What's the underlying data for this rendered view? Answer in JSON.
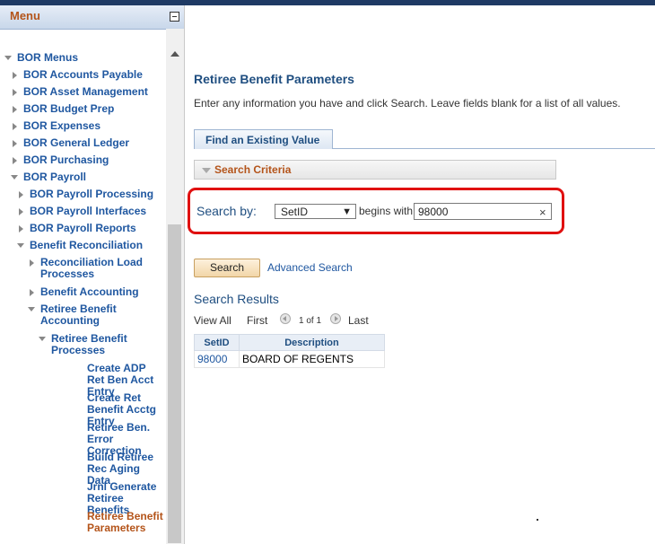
{
  "menu": {
    "title": "Menu",
    "items": [
      {
        "label": "BOR Menus",
        "expand": "down",
        "indent": 0,
        "lines": 1
      },
      {
        "label": "BOR Accounts Payable",
        "expand": "right",
        "indent": 1,
        "lines": 1
      },
      {
        "label": "BOR Asset Management",
        "expand": "right",
        "indent": 1,
        "lines": 1
      },
      {
        "label": "BOR Budget Prep",
        "expand": "right",
        "indent": 1,
        "lines": 1
      },
      {
        "label": "BOR Expenses",
        "expand": "right",
        "indent": 1,
        "lines": 1
      },
      {
        "label": "BOR General Ledger",
        "expand": "right",
        "indent": 1,
        "lines": 1
      },
      {
        "label": "BOR Purchasing",
        "expand": "right",
        "indent": 1,
        "lines": 1
      },
      {
        "label": "BOR Payroll",
        "expand": "down",
        "indent": 1,
        "lines": 1
      },
      {
        "label": "BOR Payroll Processing",
        "expand": "right",
        "indent": 2,
        "lines": 1
      },
      {
        "label": "BOR Payroll Interfaces",
        "expand": "right",
        "indent": 2,
        "lines": 1
      },
      {
        "label": "BOR Payroll Reports",
        "expand": "right",
        "indent": 2,
        "lines": 1
      },
      {
        "label": "Benefit Reconciliation",
        "expand": "down",
        "indent": 2,
        "lines": 1
      },
      {
        "label": "Reconciliation Load Processes",
        "expand": "right",
        "indent": 3,
        "lines": 2
      },
      {
        "label": "Benefit Accounting",
        "expand": "right",
        "indent": 3,
        "lines": 1
      },
      {
        "label": "Retiree Benefit Accounting",
        "expand": "down",
        "indent": 3,
        "lines": 2
      },
      {
        "label": "Retiree Benefit Processes",
        "expand": "down",
        "indent": 4,
        "lines": 2
      },
      {
        "label": "Create ADP Ret Ben Acct Entry",
        "expand": "none",
        "indent": 5,
        "lines": 2
      },
      {
        "label": "Create Ret Benefit Acctg Entry",
        "expand": "none",
        "indent": 5,
        "lines": 2
      },
      {
        "label": "Retiree Ben. Error Correction",
        "expand": "none",
        "indent": 5,
        "lines": 2
      },
      {
        "label": "Build Retiree Rec Aging Data",
        "expand": "none",
        "indent": 5,
        "lines": 2
      },
      {
        "label": "Jrnl Generate Retiree Benefits",
        "expand": "none",
        "indent": 5,
        "lines": 2
      },
      {
        "label": "Retiree Benefit Parameters",
        "expand": "none",
        "indent": 5,
        "lines": 2,
        "active": true
      }
    ]
  },
  "page": {
    "title": "Retiree Benefit Parameters",
    "instructions": "Enter any information you have and click Search. Leave fields blank for a list of all values.",
    "tab_label": "Find an Existing Value",
    "criteria_label": "Search Criteria",
    "search_by_label": "Search by:",
    "field_value": "SetID",
    "operator_label": "begins with",
    "value": "98000",
    "search_button": "Search",
    "advanced_link": "Advanced Search",
    "results_title": "Search Results"
  },
  "pager": {
    "view_all": "View All",
    "first": "First",
    "page_text": "1 of 1",
    "last": "Last"
  },
  "results": {
    "columns": [
      "SetID",
      "Description"
    ],
    "rows": [
      [
        "98000",
        "BOARD OF REGENTS"
      ]
    ]
  },
  "colors": {
    "menu_link": "#1f57a0",
    "active_link": "#b4541a",
    "highlight": "#e01010",
    "title_blue": "#1f4e80"
  }
}
